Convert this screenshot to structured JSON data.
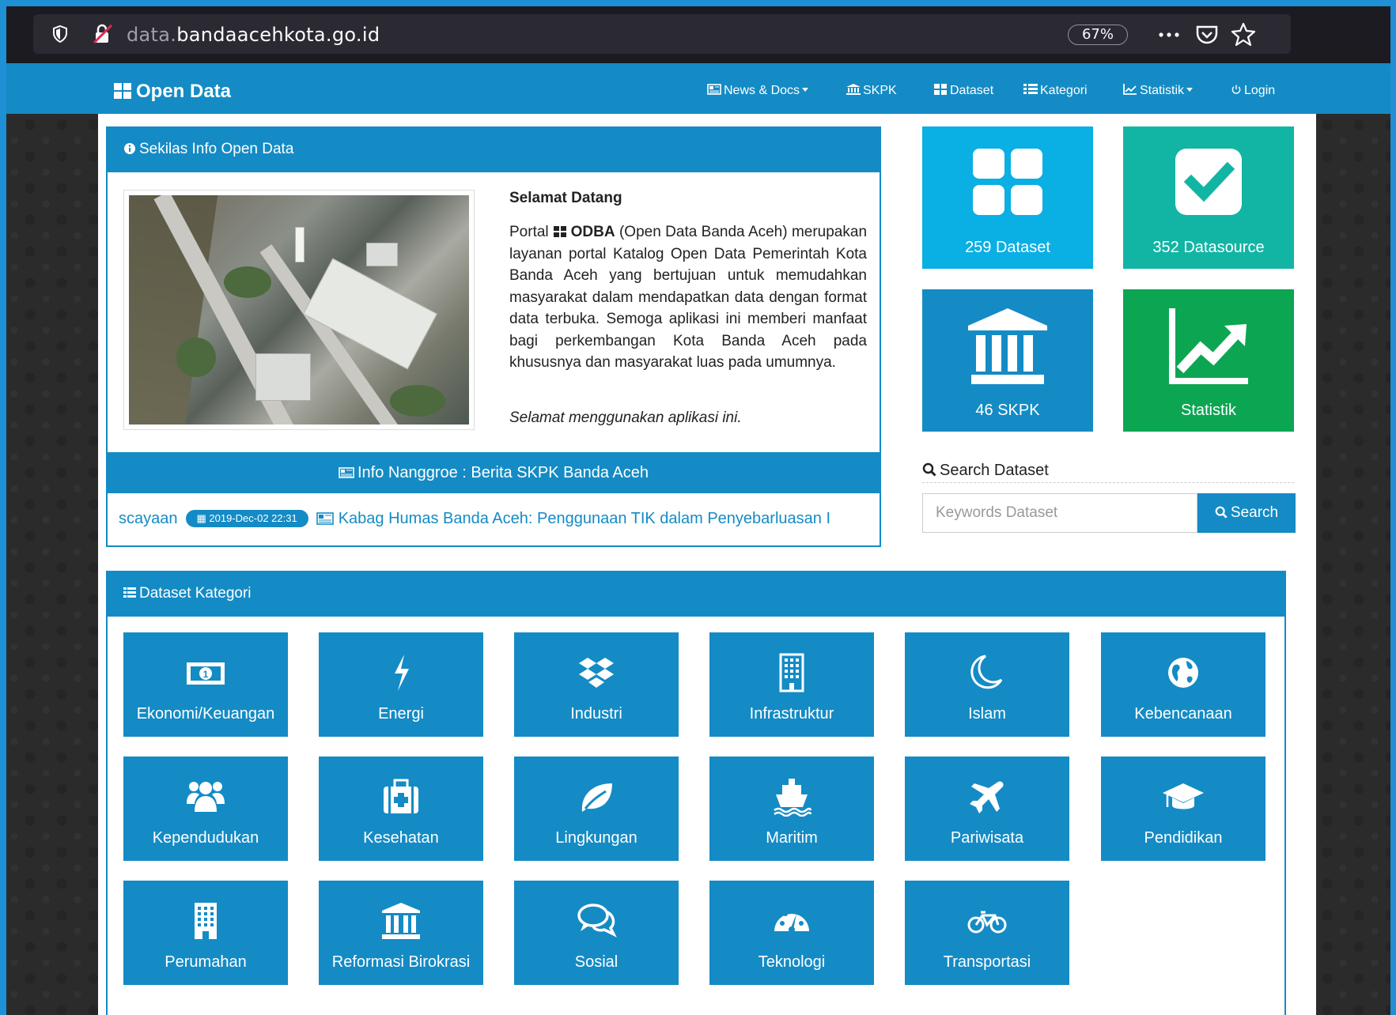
{
  "browser": {
    "url_prefix": "data.",
    "url_domain": "bandaacehkota.go.id",
    "zoom": "67%"
  },
  "navbar": {
    "brand": "Open Data",
    "items": [
      {
        "label": "News & Docs",
        "icon": "newspaper-icon",
        "dropdown": true
      },
      {
        "label": "SKPK",
        "icon": "institution-icon",
        "dropdown": false
      },
      {
        "label": "Dataset",
        "icon": "grid-icon",
        "dropdown": false
      },
      {
        "label": "Kategori",
        "icon": "list-icon",
        "dropdown": false
      },
      {
        "label": "Statistik",
        "icon": "chart-icon",
        "dropdown": true
      },
      {
        "label": "Login",
        "icon": "power-icon",
        "dropdown": false
      }
    ]
  },
  "info": {
    "heading": "Sekilas Info Open Data",
    "welcome_title": "Selamat Datang",
    "body_prefix": "Portal",
    "body_brand": "ODBA",
    "body_text": "(Open Data Banda Aceh) merupakan layanan portal Katalog Open Data Pemerintah Kota Banda Aceh yang bertujuan untuk memudahkan masyarakat dalam mendapatkan data dengan format data terbuka. Semoga aplikasi ini memberi manfaat bagi perkembangan Kota Banda Aceh pada khususnya dan masyarakat luas pada umumnya.",
    "closing": "Selamat menggunakan aplikasi ini."
  },
  "news": {
    "heading": "Info Nanggroe : Berita SKPK Banda Aceh",
    "ticker_lead": "scayaan",
    "date": "2019-Dec-02 22:31",
    "headline": "Kabag Humas Banda Aceh: Penggunaan TIK dalam Penyebarluasan I"
  },
  "stats": {
    "dataset": "259 Dataset",
    "datasource": "352 Datasource",
    "skpk": "46 SKPK",
    "statistik": "Statistik"
  },
  "search": {
    "title": "Search Dataset",
    "placeholder": "Keywords Dataset",
    "button": "Search"
  },
  "categories": {
    "heading": "Dataset Kategori",
    "items": [
      {
        "label": "Ekonomi/Keuangan",
        "icon": "money-icon"
      },
      {
        "label": "Energi",
        "icon": "bolt-icon"
      },
      {
        "label": "Industri",
        "icon": "dropbox-icon"
      },
      {
        "label": "Infrastruktur",
        "icon": "building-icon"
      },
      {
        "label": "Islam",
        "icon": "moon-icon"
      },
      {
        "label": "Kebencanaan",
        "icon": "globe-icon"
      },
      {
        "label": "Kependudukan",
        "icon": "users-icon"
      },
      {
        "label": "Kesehatan",
        "icon": "medkit-icon"
      },
      {
        "label": "Lingkungan",
        "icon": "leaf-icon"
      },
      {
        "label": "Maritim",
        "icon": "ship-icon"
      },
      {
        "label": "Pariwisata",
        "icon": "plane-icon"
      },
      {
        "label": "Pendidikan",
        "icon": "graduation-cap-icon"
      },
      {
        "label": "Perumahan",
        "icon": "apartment-icon"
      },
      {
        "label": "Reformasi Birokrasi",
        "icon": "institution-icon"
      },
      {
        "label": "Sosial",
        "icon": "comments-icon"
      },
      {
        "label": "Teknologi",
        "icon": "dashboard-icon"
      },
      {
        "label": "Transportasi",
        "icon": "bicycle-icon"
      }
    ]
  }
}
